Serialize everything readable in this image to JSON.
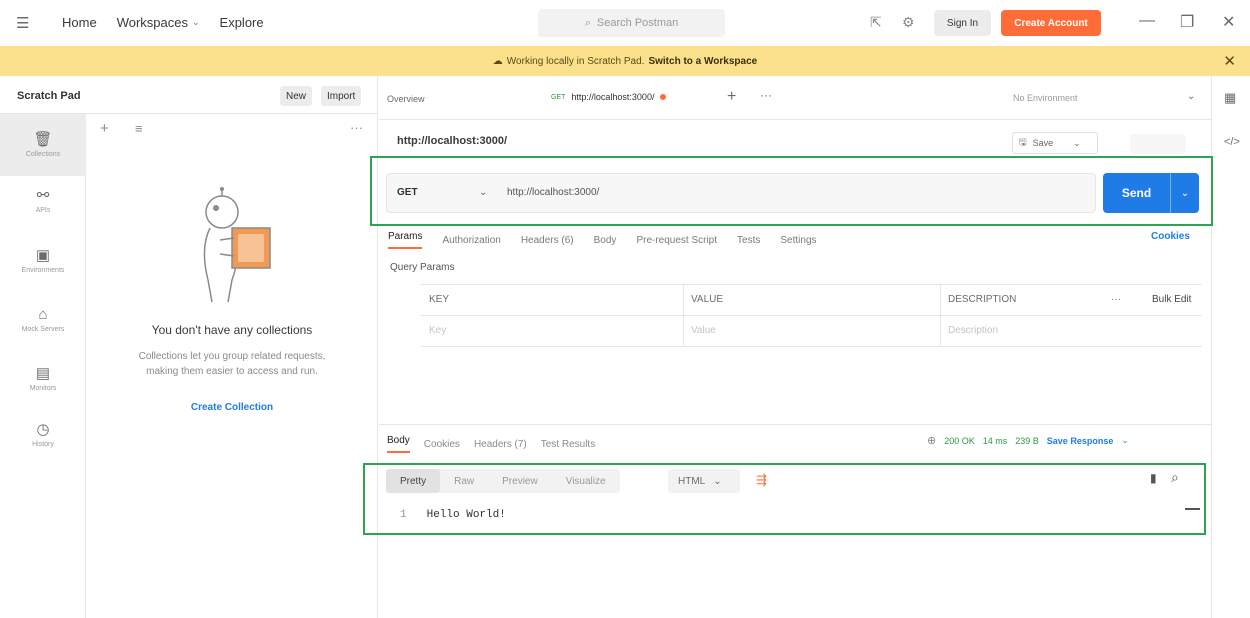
{
  "header": {
    "nav": [
      "Home",
      "Workspaces",
      "Explore"
    ],
    "search_placeholder": "Search Postman",
    "signin": "Sign In",
    "create_account": "Create Account"
  },
  "banner": {
    "text": "Working locally in Scratch Pad.",
    "link": "Switch to a Workspace"
  },
  "sidebar": {
    "title": "Scratch Pad",
    "new_label": "New",
    "import_label": "Import",
    "rail": [
      "Collections",
      "APIs",
      "Environments",
      "Mock Servers",
      "Monitors",
      "History"
    ],
    "empty_title": "You don't have any collections",
    "empty_desc_1": "Collections let you group related requests,",
    "empty_desc_2": "making them easier to access and run.",
    "create_collection": "Create Collection"
  },
  "tabs": {
    "overview": "Overview",
    "active_method": "GET",
    "active_url": "http://localhost:3000/",
    "environment": "No Environment"
  },
  "request": {
    "name": "http://localhost:3000/",
    "save": "Save",
    "method": "GET",
    "url": "http://localhost:3000/",
    "send": "Send",
    "tabs": [
      "Params",
      "Authorization",
      "Headers (6)",
      "Body",
      "Pre-request Script",
      "Tests",
      "Settings"
    ],
    "cookies": "Cookies",
    "query_params": "Query Params",
    "columns": [
      "KEY",
      "VALUE",
      "DESCRIPTION"
    ],
    "bulk_edit": "Bulk Edit",
    "placeholders": [
      "Key",
      "Value",
      "Description"
    ]
  },
  "response": {
    "tabs": [
      "Body",
      "Cookies",
      "Headers (7)",
      "Test Results"
    ],
    "status": "200 OK",
    "time": "14 ms",
    "size": "239 B",
    "save_response": "Save Response",
    "formats": [
      "Pretty",
      "Raw",
      "Preview",
      "Visualize"
    ],
    "language": "HTML",
    "line_number": "1",
    "body": "Hello World!"
  }
}
